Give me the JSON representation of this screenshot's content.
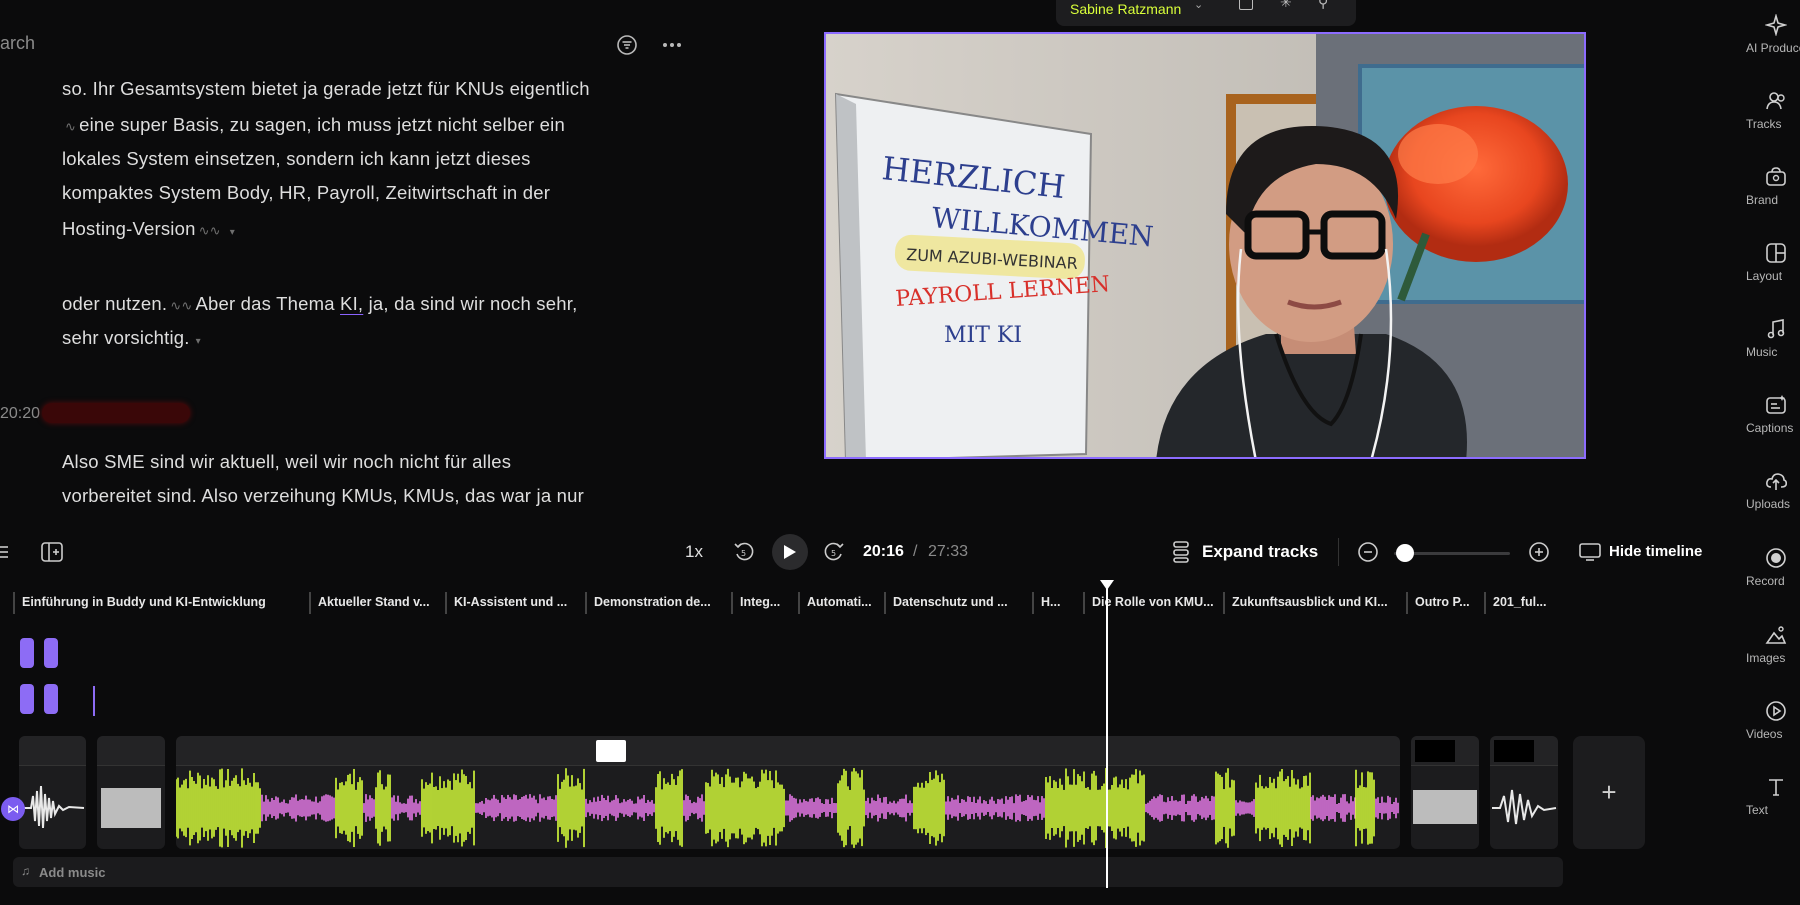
{
  "search": {
    "placeholder": "arch"
  },
  "transcript": {
    "lines": [
      "so. Ihr Gesamtsystem bietet ja gerade jetzt für KNUs eigentlich",
      "eine super Basis, zu sagen, ich muss jetzt nicht selber ein",
      "lokales System einsetzen, sondern ich kann jetzt dieses",
      "kompaktes System Body, HR, Payroll, Zeitwirtschaft in der",
      "Hosting-Version"
    ],
    "line6_a": "oder nutzen.",
    "line6_b": "Aber das Thema ",
    "line6_c": "KI,",
    "line6_d": " ja, da sind wir noch sehr,",
    "line7": "sehr vorsichtig.",
    "speaker_time": "20:20",
    "line8": "Also SME sind wir aktuell, weil wir noch nicht für alles",
    "line9": "vorbereitet sind. Also verzeihung KMUs, KMUs, das war ja nur"
  },
  "speaker_pill": {
    "name": "Sabine Ratzmann"
  },
  "video": {
    "flipchart_lines": [
      "HERZLICH",
      "WILLKOMMEN",
      "ZUM AZUBI-WEBINAR",
      "PAYROLL LERNEN",
      "MIT KI"
    ]
  },
  "sidebar": {
    "items": [
      {
        "label": "AI Produce",
        "icon": "sparkle-icon"
      },
      {
        "label": "Tracks",
        "icon": "users-icon"
      },
      {
        "label": "Brand",
        "icon": "brand-kit-icon"
      },
      {
        "label": "Layout",
        "icon": "layout-icon"
      },
      {
        "label": "Music",
        "icon": "music-note-icon"
      },
      {
        "label": "Captions",
        "icon": "captions-icon"
      },
      {
        "label": "Uploads",
        "icon": "upload-icon"
      },
      {
        "label": "Record",
        "icon": "record-icon"
      },
      {
        "label": "Images",
        "icon": "image-icon"
      },
      {
        "label": "Videos",
        "icon": "video-play-icon"
      },
      {
        "label": "Text",
        "icon": "text-icon"
      }
    ]
  },
  "controls": {
    "speed": "1x",
    "current_time": "20:16",
    "separator": "/",
    "total_time": "27:33",
    "expand_label": "Expand tracks",
    "hide_label": "Hide timeline",
    "zoom_level": 0.0
  },
  "chapters": [
    "Einführung in Buddy und KI-Entwicklung",
    "Aktueller Stand v...",
    "KI-Assistent und ...",
    "Demonstration de...",
    "Integ...",
    "Automati...",
    "Datenschutz und ...",
    "H...",
    "Die Rolle von KMU...",
    "Zukunftsausblick und KI...",
    "Outro P...",
    "201_ful..."
  ],
  "music": {
    "label": "Add music"
  },
  "colors": {
    "accent": "#8c6cff",
    "speech": "#d7ff3a",
    "pause": "#e77ae9"
  }
}
